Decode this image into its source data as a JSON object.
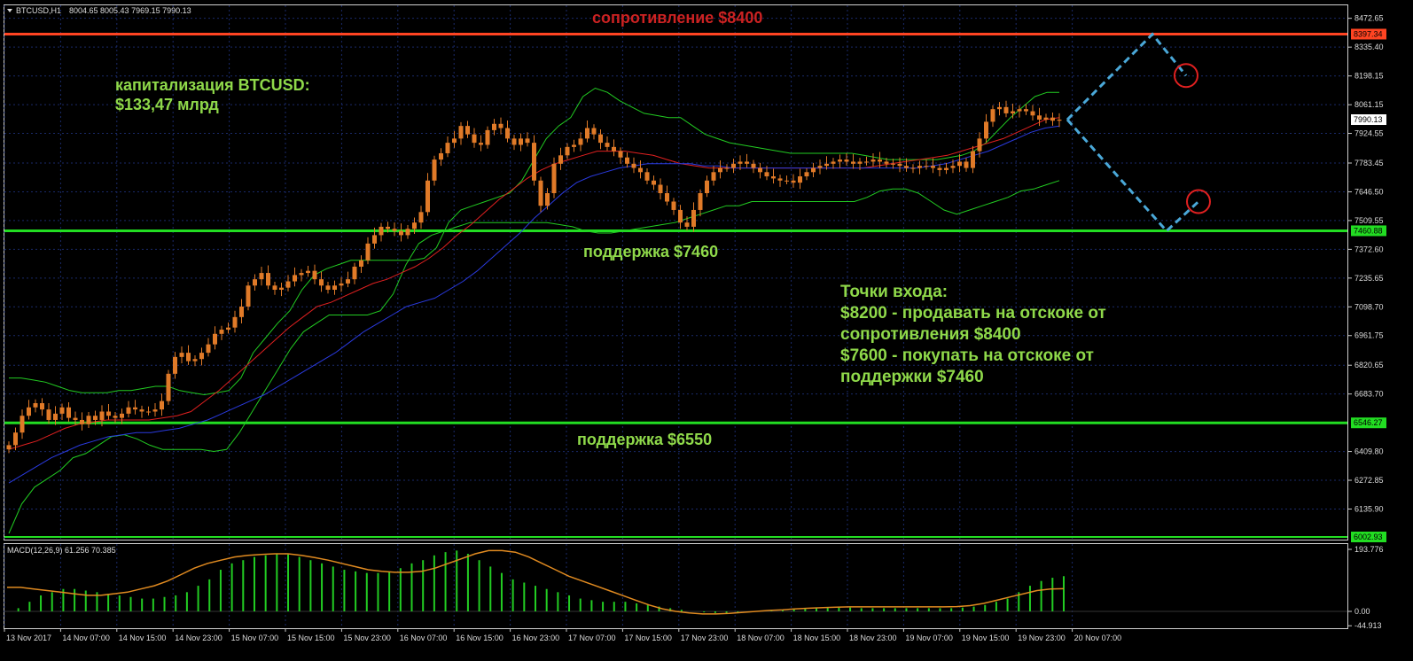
{
  "header": {
    "symbol_label": "BTCUSD,H1",
    "ohlc": "8004.65 8005.43 7969.15 7990.13"
  },
  "macd": {
    "label": "MACD(12,26,9) 61.256 70.385",
    "ticks": [
      "193.776",
      "0.00",
      "-44.913"
    ],
    "ticks_values": [
      193.776,
      0.0,
      -44.913
    ]
  },
  "annotations": {
    "resistance": "сопротивление $8400",
    "cap_line1": "капитализация BTCUSD:",
    "cap_line2": "$133,47 млрд",
    "support_7460": "поддержка $7460",
    "support_6550": "поддержка $6550",
    "entry_title": "Точки входа:",
    "entry_line1": "$8200 - продавать на отскоке от",
    "entry_line2": "сопротивления $8400",
    "entry_line3": "$7600 - покупать на отскоке от",
    "entry_line4": "поддержки $7460"
  },
  "colors": {
    "background": "#000000",
    "grid": "#1a2a6a",
    "candle": "#e07a28",
    "resistance_line": "#ff4422",
    "support_line": "#22dd22",
    "bands": "#22cc22",
    "ma_red": "#e02020",
    "ma_blue": "#2a3adf",
    "macd_hist": "#22cc22",
    "macd_signal": "#e08a20",
    "forecast": "#4aa8d8",
    "target_circle": "#e02020",
    "annot_green": "#8fd94a",
    "annot_red": "#cc2222"
  },
  "chart_data": {
    "type": "candlestick",
    "symbol": "BTCUSD",
    "timeframe": "H1",
    "x_labels": [
      "13 Nov 2017",
      "14 Nov 07:00",
      "14 Nov 15:00",
      "14 Nov 23:00",
      "15 Nov 07:00",
      "15 Nov 15:00",
      "15 Nov 23:00",
      "16 Nov 07:00",
      "16 Nov 15:00",
      "16 Nov 23:00",
      "17 Nov 07:00",
      "17 Nov 15:00",
      "17 Nov 23:00",
      "18 Nov 07:00",
      "18 Nov 15:00",
      "18 Nov 23:00",
      "19 Nov 07:00",
      "19 Nov 15:00",
      "19 Nov 23:00",
      "20 Nov 07:00"
    ],
    "y_ticks": [
      "8472.65",
      "8335.40",
      "8198.15",
      "8061.15",
      "7924.55",
      "7783.45",
      "7646.50",
      "7509.55",
      "7372.60",
      "7235.65",
      "7098.70",
      "6961.75",
      "6820.65",
      "6683.70",
      "6409.80",
      "6272.85",
      "6135.90"
    ],
    "y_tick_values": [
      8472.65,
      8335.4,
      8198.15,
      8061.15,
      7924.55,
      7783.45,
      7646.5,
      7509.55,
      7372.6,
      7235.65,
      7098.7,
      6961.75,
      6820.65,
      6683.7,
      6409.8,
      6272.85,
      6135.9
    ],
    "ylim": [
      6002.93,
      8540
    ],
    "price_tags": [
      {
        "label": "8397.34",
        "value": 8397.34,
        "kind": "resistance"
      },
      {
        "label": "7990.13",
        "value": 7990.13,
        "kind": "current"
      },
      {
        "label": "7460.88",
        "value": 7460.88,
        "kind": "support"
      },
      {
        "label": "6546.27",
        "value": 6546.27,
        "kind": "support"
      },
      {
        "label": "6002.93",
        "value": 6002.93,
        "kind": "support"
      }
    ],
    "levels": {
      "resistance": 8397.34,
      "support_high": 7460.88,
      "support_low": 6546.27,
      "support_bottom": 6002.93
    },
    "close": [
      6440,
      6500,
      6580,
      6620,
      6640,
      6610,
      6560,
      6590,
      6620,
      6570,
      6560,
      6540,
      6580,
      6560,
      6600,
      6580,
      6570,
      6590,
      6620,
      6610,
      6600,
      6600,
      6610,
      6650,
      6780,
      6860,
      6880,
      6840,
      6850,
      6880,
      6920,
      6970,
      6990,
      7000,
      7050,
      7100,
      7200,
      7230,
      7260,
      7200,
      7180,
      7190,
      7220,
      7250,
      7260,
      7270,
      7230,
      7200,
      7180,
      7200,
      7210,
      7230,
      7290,
      7320,
      7400,
      7440,
      7480,
      7470,
      7460,
      7440,
      7470,
      7500,
      7550,
      7700,
      7800,
      7830,
      7880,
      7900,
      7960,
      7920,
      7880,
      7870,
      7940,
      7970,
      7950,
      7900,
      7870,
      7900,
      7880,
      7700,
      7580,
      7640,
      7780,
      7820,
      7860,
      7870,
      7900,
      7950,
      7920,
      7880,
      7860,
      7840,
      7810,
      7780,
      7760,
      7740,
      7700,
      7680,
      7640,
      7600,
      7560,
      7500,
      7480,
      7560,
      7640,
      7700,
      7740,
      7760,
      7760,
      7780,
      7790,
      7780,
      7760,
      7740,
      7720,
      7710,
      7700,
      7700,
      7690,
      7720,
      7740,
      7760,
      7770,
      7780,
      7790,
      7800,
      7790,
      7780,
      7790,
      7790,
      7800,
      7790,
      7780,
      7780,
      7770,
      7760,
      7760,
      7770,
      7770,
      7760,
      7750,
      7760,
      7770,
      7790,
      7760,
      7840,
      7900,
      7980,
      8040,
      8050,
      8020,
      8030,
      8040,
      8030,
      8010,
      7990,
      8000,
      7985,
      7990
    ],
    "upper_band": [
      6760,
      6760,
      6750,
      6740,
      6720,
      6700,
      6690,
      6690,
      6690,
      6700,
      6700,
      6710,
      6720,
      6720,
      6700,
      6690,
      6680,
      6690,
      6700,
      6760,
      6880,
      6950,
      7020,
      7080,
      7180,
      7250,
      7280,
      7300,
      7320,
      7320,
      7320,
      7320,
      7320,
      7320,
      7330,
      7380,
      7500,
      7560,
      7580,
      7600,
      7620,
      7640,
      7700,
      7800,
      7900,
      7960,
      8000,
      8100,
      8140,
      8120,
      8080,
      8050,
      8020,
      8010,
      8000,
      8000,
      7960,
      7920,
      7900,
      7880,
      7870,
      7860,
      7850,
      7840,
      7830,
      7830,
      7830,
      7830,
      7830,
      7830,
      7820,
      7810,
      7800,
      7800,
      7800,
      7800,
      7800,
      7810,
      7820,
      7840,
      7880,
      7940,
      8000,
      8050,
      8100,
      8120,
      8120
    ],
    "lower_band": [
      6020,
      6160,
      6240,
      6280,
      6320,
      6380,
      6400,
      6440,
      6480,
      6490,
      6470,
      6440,
      6420,
      6420,
      6420,
      6420,
      6410,
      6420,
      6500,
      6600,
      6700,
      6800,
      6900,
      6980,
      7020,
      7060,
      7060,
      7060,
      7060,
      7080,
      7160,
      7300,
      7400,
      7440,
      7460,
      7480,
      7500,
      7500,
      7500,
      7500,
      7500,
      7500,
      7500,
      7490,
      7480,
      7460,
      7450,
      7450,
      7460,
      7470,
      7480,
      7490,
      7500,
      7520,
      7540,
      7560,
      7580,
      7580,
      7600,
      7600,
      7600,
      7600,
      7600,
      7600,
      7600,
      7600,
      7600,
      7620,
      7650,
      7660,
      7660,
      7640,
      7600,
      7560,
      7540,
      7560,
      7580,
      7600,
      7620,
      7650,
      7660,
      7680,
      7700
    ],
    "ma_red": [
      6420,
      6440,
      6460,
      6490,
      6520,
      6540,
      6550,
      6560,
      6560,
      6560,
      6560,
      6570,
      6580,
      6600,
      6650,
      6700,
      6760,
      6820,
      6880,
      6940,
      7000,
      7050,
      7100,
      7120,
      7150,
      7180,
      7210,
      7230,
      7260,
      7290,
      7330,
      7380,
      7440,
      7490,
      7550,
      7610,
      7660,
      7710,
      7750,
      7780,
      7800,
      7820,
      7840,
      7840,
      7840,
      7830,
      7820,
      7800,
      7780,
      7770,
      7760,
      7760,
      7760,
      7760,
      7760,
      7760,
      7760,
      7760,
      7760,
      7760,
      7760,
      7760,
      7770,
      7780,
      7790,
      7800,
      7810,
      7820,
      7840,
      7860,
      7880,
      7900,
      7930,
      7960,
      7990,
      8000
    ],
    "ma_blue": [
      6260,
      6300,
      6340,
      6380,
      6410,
      6440,
      6460,
      6480,
      6490,
      6500,
      6500,
      6510,
      6520,
      6540,
      6560,
      6590,
      6620,
      6650,
      6680,
      6720,
      6760,
      6800,
      6840,
      6880,
      6930,
      6980,
      7020,
      7060,
      7100,
      7120,
      7140,
      7180,
      7220,
      7270,
      7330,
      7390,
      7450,
      7520,
      7580,
      7640,
      7690,
      7720,
      7740,
      7760,
      7770,
      7780,
      7780,
      7780,
      7780,
      7770,
      7770,
      7760,
      7760,
      7760,
      7760,
      7760,
      7760,
      7760,
      7760,
      7760,
      7760,
      7760,
      7760,
      7760,
      7760,
      7770,
      7780,
      7800,
      7820,
      7840,
      7870,
      7900,
      7930,
      7950,
      7960
    ],
    "macd_histogram": [
      0,
      10,
      30,
      50,
      60,
      70,
      70,
      65,
      60,
      55,
      50,
      45,
      40,
      40,
      45,
      50,
      60,
      80,
      100,
      130,
      150,
      160,
      170,
      175,
      180,
      178,
      170,
      160,
      150,
      140,
      130,
      125,
      120,
      120,
      125,
      135,
      150,
      160,
      175,
      185,
      190,
      180,
      160,
      140,
      120,
      100,
      90,
      80,
      70,
      60,
      50,
      40,
      35,
      30,
      30,
      30,
      25,
      20,
      15,
      10,
      5,
      0,
      -3,
      -5,
      -5,
      -5,
      -3,
      0,
      3,
      5,
      8,
      10,
      12,
      12,
      12,
      12,
      10,
      10,
      10,
      10,
      10,
      10,
      10,
      10,
      10,
      12,
      15,
      20,
      30,
      40,
      60,
      80,
      95,
      105,
      110
    ],
    "macd_signal": [
      75,
      75,
      70,
      65,
      60,
      55,
      50,
      50,
      55,
      60,
      70,
      80,
      95,
      115,
      135,
      150,
      160,
      170,
      175,
      178,
      180,
      180,
      175,
      168,
      160,
      150,
      140,
      130,
      125,
      122,
      122,
      125,
      135,
      150,
      165,
      180,
      190,
      190,
      185,
      170,
      150,
      130,
      110,
      95,
      80,
      65,
      50,
      35,
      20,
      8,
      0,
      -5,
      -8,
      -8,
      -6,
      -3,
      0,
      3,
      5,
      8,
      10,
      12,
      13,
      14,
      14,
      14,
      14,
      14,
      14,
      14,
      14,
      15,
      18,
      25,
      35,
      45,
      55,
      65,
      70,
      71
    ],
    "forecast": {
      "points": [
        [
          "20 Nov 01:00",
          7990
        ],
        [
          "21 Nov 00:00",
          8397
        ],
        [
          "21 Nov 04:00",
          8200
        ],
        [
          "20 Nov 01:00",
          7990
        ],
        [
          "21 Nov 01:00",
          7460
        ],
        [
          "21 Nov 04:00",
          7600
        ]
      ],
      "targets": [
        8200,
        7600
      ]
    }
  }
}
